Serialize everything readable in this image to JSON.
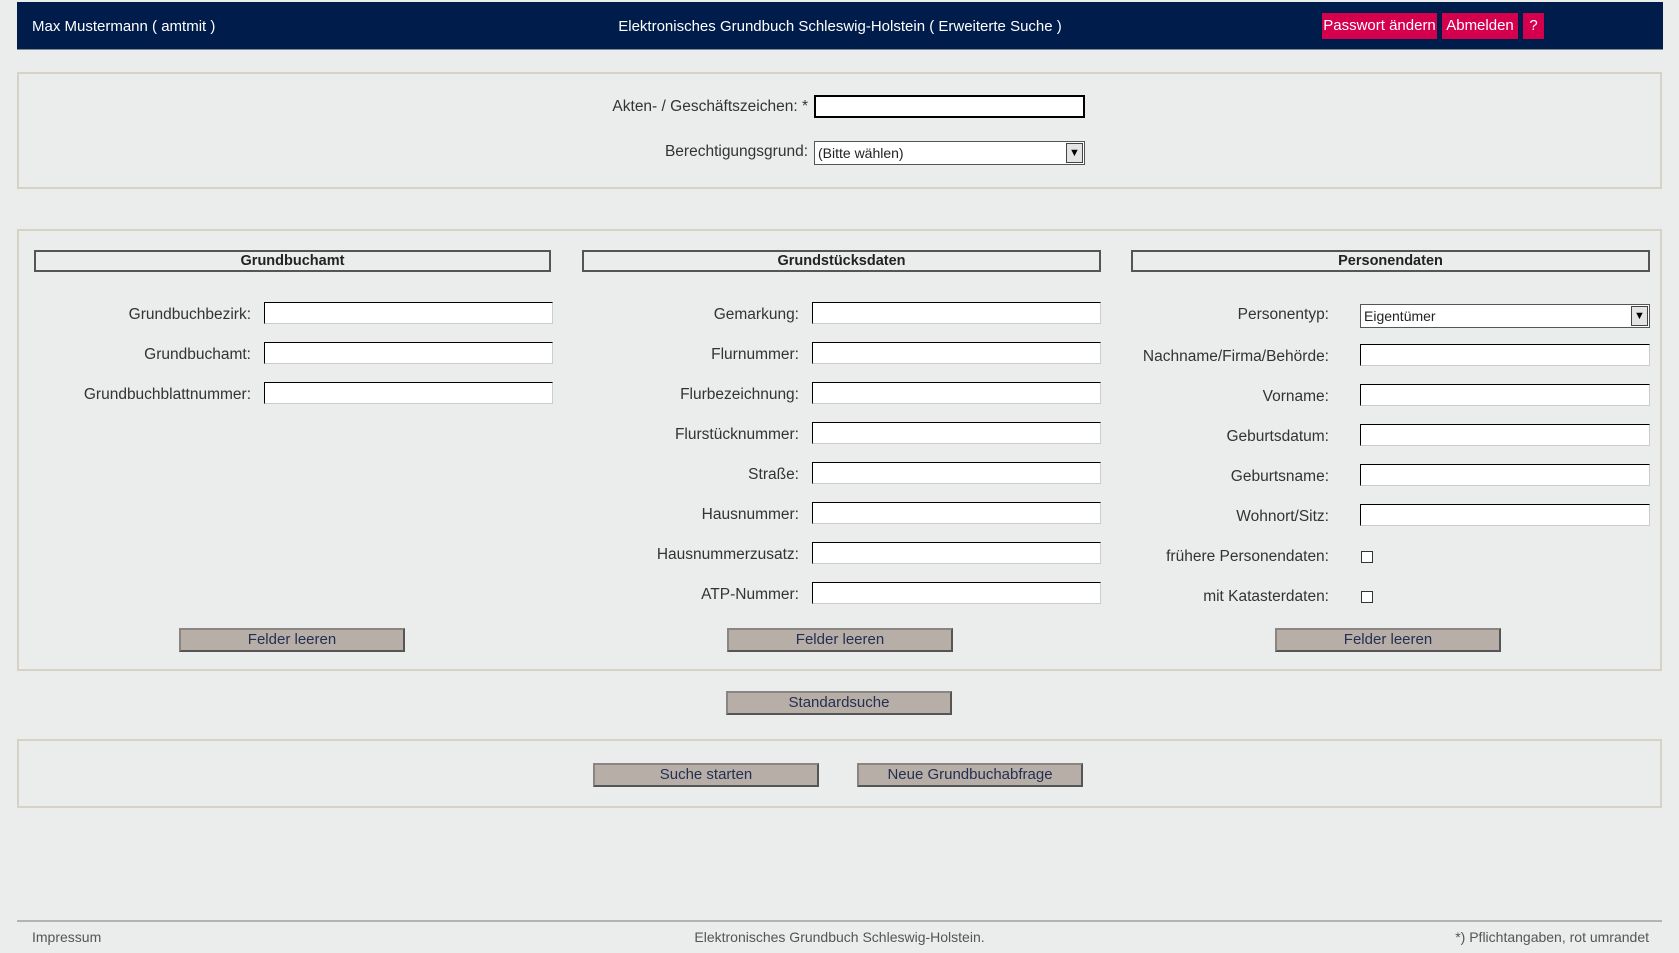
{
  "header": {
    "user": "Max Mustermann  ( amtmit )",
    "title": "Elektronisches Grundbuch Schleswig-Holstein  ( Erweiterte Suche )",
    "password_button": "Passwort ändern",
    "logout_button": "Abmelden",
    "help_button": "?"
  },
  "top_panel": {
    "aktenzeichen_label": "Akten- / Geschäftszeichen: *",
    "aktenzeichen_value": "",
    "berechtigung_label": "Berechtigungsgrund:",
    "berechtigung_value": "(Bitte wählen)"
  },
  "grundbuchamt": {
    "heading": "Grundbuchamt",
    "fields": [
      {
        "label": "Grundbuchbezirk:",
        "value": ""
      },
      {
        "label": "Grundbuchamt:",
        "value": ""
      },
      {
        "label": "Grundbuchblattnummer:",
        "value": ""
      }
    ],
    "clear_button": "Felder leeren"
  },
  "grundstueck": {
    "heading": "Grundstücksdaten",
    "fields": [
      {
        "label": "Gemarkung:",
        "value": ""
      },
      {
        "label": "Flurnummer:",
        "value": ""
      },
      {
        "label": "Flurbezeichnung:",
        "value": ""
      },
      {
        "label": "Flurstücknummer:",
        "value": ""
      },
      {
        "label": "Straße:",
        "value": ""
      },
      {
        "label": "Hausnummer:",
        "value": ""
      },
      {
        "label": "Hausnummerzusatz:",
        "value": ""
      },
      {
        "label": "ATP-Nummer:",
        "value": ""
      }
    ],
    "clear_button": "Felder leeren"
  },
  "personen": {
    "heading": "Personendaten",
    "personentyp_label": "Personentyp:",
    "personentyp_value": "Eigentümer",
    "fields": [
      {
        "label": "Nachname/Firma/Behörde:",
        "value": ""
      },
      {
        "label": "Vorname:",
        "value": ""
      },
      {
        "label": "Geburtsdatum:",
        "value": ""
      },
      {
        "label": "Geburtsname:",
        "value": ""
      },
      {
        "label": "Wohnort/Sitz:",
        "value": ""
      }
    ],
    "checkbox_fruehere": "frühere Personendaten:",
    "checkbox_kataster": "mit Katasterdaten:",
    "clear_button": "Felder leeren"
  },
  "standard_button": "Standardsuche",
  "actions": {
    "search_button": "Suche starten",
    "new_query_button": "Neue Grundbuchabfrage"
  },
  "footer": {
    "impressum": "Impressum",
    "center": "Elektronisches Grundbuch Schleswig-Holstein.",
    "note": "*) Pflichtangaben, rot umrandet"
  },
  "colors": {
    "header_bg": "#001c4a",
    "accent": "#d4004d",
    "button_bg": "#b8aea8",
    "page_bg": "#eaedeb"
  }
}
